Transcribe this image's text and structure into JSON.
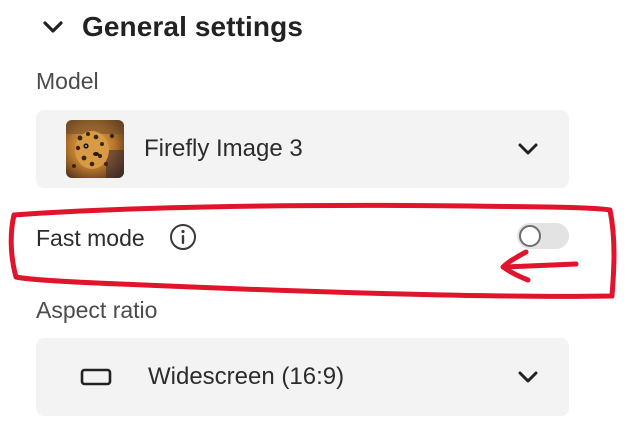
{
  "section": {
    "title": "General settings",
    "chevron_icon": "chevron-down-icon"
  },
  "model": {
    "label": "Model",
    "selected": "Firefly Image 3",
    "thumbnail_icon": "leopard-thumbnail"
  },
  "fast_mode": {
    "label": "Fast mode",
    "info_icon": "info-icon",
    "enabled": false
  },
  "aspect_ratio": {
    "label": "Aspect ratio",
    "selected": "Widescreen (16:9)",
    "shape_icon": "widescreen-rectangle-icon"
  },
  "annotation": {
    "color": "#e0142a",
    "shape": "hand-drawn-box-with-arrow"
  }
}
